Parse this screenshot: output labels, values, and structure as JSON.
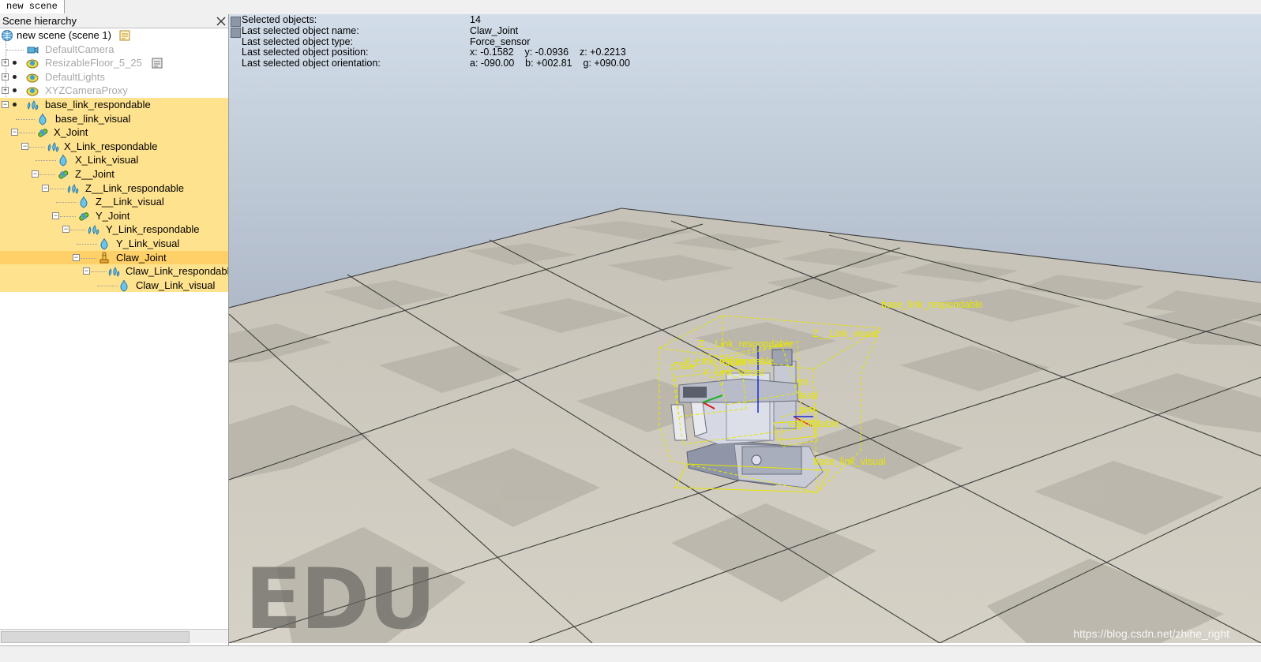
{
  "tab": {
    "label": "new scene"
  },
  "hierarchy": {
    "title": "Scene hierarchy",
    "items": [
      {
        "label": "new scene (scene 1)"
      },
      {
        "label": "DefaultCamera"
      },
      {
        "label": "ResizableFloor_5_25"
      },
      {
        "label": "DefaultLights"
      },
      {
        "label": "XYZCameraProxy"
      },
      {
        "label": "base_link_respondable"
      },
      {
        "label": "base_link_visual"
      },
      {
        "label": "X_Joint"
      },
      {
        "label": "X_Link_respondable"
      },
      {
        "label": "X_Link_visual"
      },
      {
        "label": "Z__Joint"
      },
      {
        "label": "Z__Link_respondable"
      },
      {
        "label": "Z__Link_visual"
      },
      {
        "label": "Y_Joint"
      },
      {
        "label": "Y_Link_respondable"
      },
      {
        "label": "Y_Link_visual"
      },
      {
        "label": "Claw_Joint"
      },
      {
        "label": "Claw_Link_respondable"
      },
      {
        "label": "Claw_Link_visual"
      }
    ]
  },
  "info": {
    "rows": [
      {
        "label": "Selected objects:",
        "value": "14"
      },
      {
        "label": "Last selected object name:",
        "value": "Claw_Joint"
      },
      {
        "label": "Last selected object type:",
        "value": "Force_sensor"
      },
      {
        "label": "Last selected object position:",
        "value": "x: -0.1582    y: -0.0936    z: +0.2213"
      },
      {
        "label": "Last selected object orientation:",
        "value": "a: -090.00    b: +002.81    g: +090.00"
      }
    ]
  },
  "scene_labels": {
    "base_link_respondable": "base_link_respondable",
    "z_link_visual": "Z__Link_visual",
    "z_link_respondable": "Z__Link_respondable",
    "y_link_respondable": "Y_Link_respondable",
    "y_link_visual": "Y_Link_visual",
    "claw": "Claw_",
    "joint": "Joint",
    "joint2": "int",
    "visual": "isual",
    "oint": "oint",
    "espondable": "espondable",
    "base_link_visual": "base_link_visual"
  },
  "watermark": {
    "edu": "EDU",
    "url": "https://blog.csdn.net/zhihe_right"
  },
  "status": {
    "text": ""
  },
  "colors": {
    "selection": "#ffe28e",
    "current_selection": "#ffcf68",
    "bbox": "#e6e600",
    "sky_top": "#cfdbe8",
    "sky_bottom": "#7d8595"
  }
}
